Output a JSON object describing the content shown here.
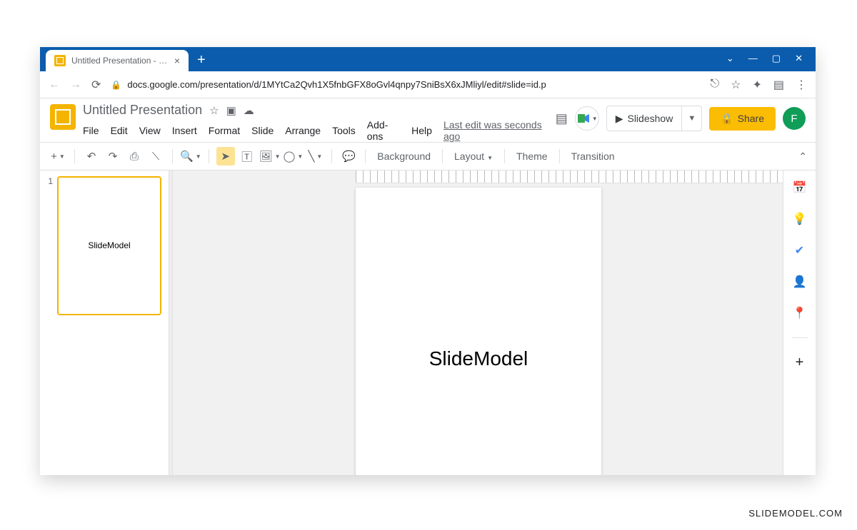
{
  "browser": {
    "tab_title": "Untitled Presentation - Google S",
    "url": "docs.google.com/presentation/d/1MYtCa2Qvh1X5fnbGFX8oGvl4qnpy7SniBsX6xJMliyl/edit#slide=id.p"
  },
  "doc": {
    "title": "Untitled Presentation",
    "menus": [
      "File",
      "Edit",
      "View",
      "Insert",
      "Format",
      "Slide",
      "Arrange",
      "Tools",
      "Add-ons",
      "Help"
    ],
    "last_edit": "Last edit was seconds ago"
  },
  "header": {
    "slideshow": "Slideshow",
    "share": "Share",
    "avatar_initial": "F"
  },
  "toolbar": {
    "background": "Background",
    "layout": "Layout",
    "theme": "Theme",
    "transition": "Transition"
  },
  "slides": [
    {
      "number": "1",
      "text": "SlideModel"
    }
  ],
  "canvas_text": "SlideModel",
  "watermark": "SLIDEMODEL.COM"
}
